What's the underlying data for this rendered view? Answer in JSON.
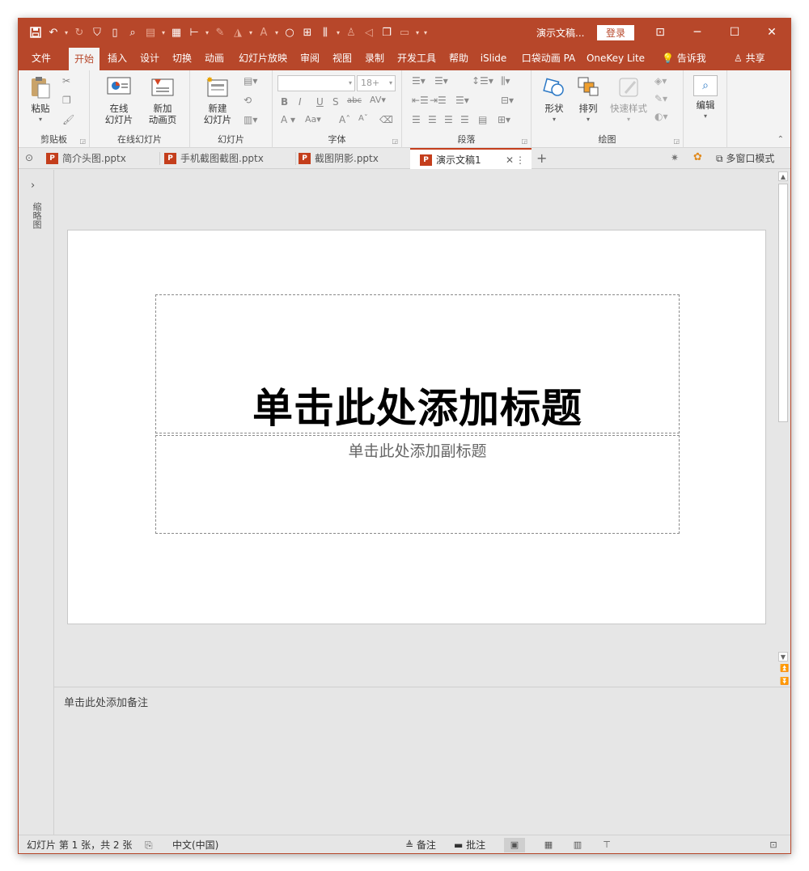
{
  "titlebar": {
    "doc_title": "演示文稿...",
    "login": "登录"
  },
  "ribbon_tabs": [
    "文件",
    "开始",
    "插入",
    "设计",
    "切换",
    "动画",
    "幻灯片放映",
    "审阅",
    "视图",
    "录制",
    "开发工具",
    "帮助",
    "iSlide",
    "口袋动画 PA",
    "OneKey Lite"
  ],
  "active_tab": "开始",
  "tell_me": "告诉我",
  "share": "共享",
  "ribbon": {
    "clipboard": {
      "paste": "粘贴",
      "label": "剪贴板"
    },
    "online": {
      "online_slide": "在线\n幻灯片",
      "new_anim": "新加\n动画页",
      "label": "在线幻灯片"
    },
    "slides": {
      "new_slide": "新建\n幻灯片",
      "label": "幻灯片"
    },
    "font": {
      "size": "18+",
      "label": "字体"
    },
    "paragraph": {
      "label": "段落"
    },
    "drawing": {
      "shape": "形状",
      "arrange": "排列",
      "quick_style": "快速样式",
      "label": "绘图"
    },
    "editing": {
      "edit": "编辑"
    }
  },
  "doc_tabs": [
    {
      "name": "简介头图.pptx"
    },
    {
      "name": "手机截图截图.pptx"
    },
    {
      "name": "截图阴影.pptx"
    },
    {
      "name": "演示文稿1"
    }
  ],
  "multi_window": "多窗口模式",
  "left_pane_label": "缩略图",
  "slide": {
    "title_placeholder": "单击此处添加标题",
    "subtitle_placeholder": "单击此处添加副标题"
  },
  "notes_placeholder": "单击此处添加备注",
  "status": {
    "slide_info": "幻灯片 第 1 张，共 2 张",
    "language": "中文(中国)",
    "notes": "备注",
    "comments": "批注"
  },
  "colors": {
    "accent": "#b7472a",
    "ribbon_bg": "#f3f3f3",
    "workspace": "#e6e6e6"
  }
}
